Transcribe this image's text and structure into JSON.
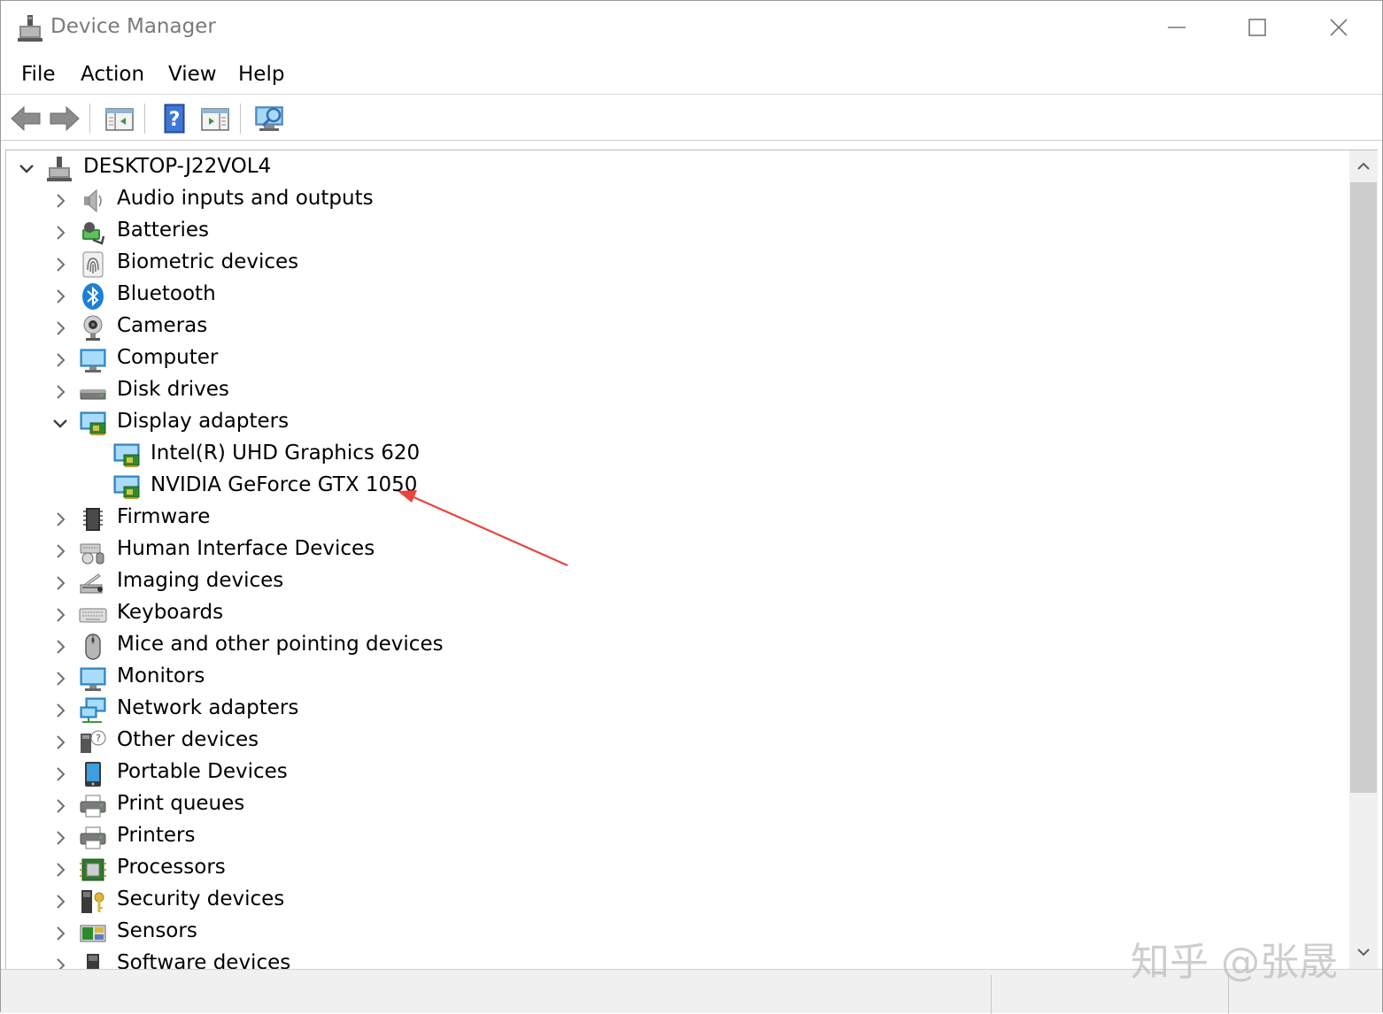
{
  "window": {
    "title": "Device Manager",
    "controls": [
      "minimize",
      "maximize",
      "close"
    ]
  },
  "menu": {
    "file": "File",
    "action": "Action",
    "view": "View",
    "help": "Help"
  },
  "toolbar": {
    "buttons": [
      "back-icon",
      "forward-icon",
      "show-hide-console-tree-icon",
      "help-icon",
      "properties-icon",
      "scan-hardware-icon"
    ]
  },
  "tree": {
    "root": "DESKTOP-J22VOL4",
    "categories": [
      {
        "label": "Audio inputs and outputs",
        "icon": "speaker-icon",
        "expanded": false
      },
      {
        "label": "Batteries",
        "icon": "battery-icon",
        "expanded": false
      },
      {
        "label": "Biometric devices",
        "icon": "fingerprint-icon",
        "expanded": false
      },
      {
        "label": "Bluetooth",
        "icon": "bluetooth-icon",
        "expanded": false
      },
      {
        "label": "Cameras",
        "icon": "camera-icon",
        "expanded": false
      },
      {
        "label": "Computer",
        "icon": "computer-icon",
        "expanded": false
      },
      {
        "label": "Disk drives",
        "icon": "disk-drive-icon",
        "expanded": false
      },
      {
        "label": "Display adapters",
        "icon": "display-adapter-icon",
        "expanded": true,
        "children": [
          {
            "label": "Intel(R) UHD Graphics 620",
            "icon": "display-adapter-icon"
          },
          {
            "label": "NVIDIA GeForce GTX 1050",
            "icon": "display-adapter-icon"
          }
        ]
      },
      {
        "label": "Firmware",
        "icon": "firmware-chip-icon",
        "expanded": false
      },
      {
        "label": "Human Interface Devices",
        "icon": "hid-icon",
        "expanded": false
      },
      {
        "label": "Imaging devices",
        "icon": "scanner-icon",
        "expanded": false
      },
      {
        "label": "Keyboards",
        "icon": "keyboard-icon",
        "expanded": false
      },
      {
        "label": "Mice and other pointing devices",
        "icon": "mouse-icon",
        "expanded": false
      },
      {
        "label": "Monitors",
        "icon": "monitor-icon",
        "expanded": false
      },
      {
        "label": "Network adapters",
        "icon": "network-adapter-icon",
        "expanded": false
      },
      {
        "label": "Other devices",
        "icon": "unknown-device-icon",
        "expanded": false
      },
      {
        "label": "Portable Devices",
        "icon": "portable-device-icon",
        "expanded": false
      },
      {
        "label": "Print queues",
        "icon": "printer-icon",
        "expanded": false
      },
      {
        "label": "Printers",
        "icon": "printer-icon",
        "expanded": false
      },
      {
        "label": "Processors",
        "icon": "processor-icon",
        "expanded": false
      },
      {
        "label": "Security devices",
        "icon": "security-key-icon",
        "expanded": false
      },
      {
        "label": "Sensors",
        "icon": "sensor-icon",
        "expanded": false
      },
      {
        "label": "Software devices",
        "icon": "software-device-icon",
        "expanded": false
      }
    ]
  },
  "annotation": {
    "arrow_color": "#e8443a",
    "points_to": "NVIDIA GeForce GTX 1050"
  },
  "watermark": "知乎 @张晟",
  "colors": {
    "accent": "#2f8fd8",
    "arrow": "#e8443a"
  }
}
